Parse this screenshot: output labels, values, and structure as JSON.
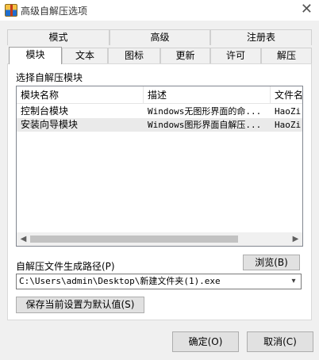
{
  "window": {
    "title": "高级自解压选项",
    "close_glyph": "✕"
  },
  "tabs_row1": [
    "模式",
    "高级",
    "注册表"
  ],
  "tabs_row2": [
    "模块",
    "文本",
    "图标",
    "更新",
    "许可",
    "解压"
  ],
  "active_tab": "模块",
  "module_section": {
    "label": "选择自解压模块",
    "columns": [
      "模块名称",
      "描述",
      "文件名"
    ],
    "rows": [
      {
        "name": "控制台模块",
        "desc": "Windows无图形界面的命...",
        "file": "HaoZi..."
      },
      {
        "name": "安装向导模块",
        "desc": "Windows图形界面自解压...",
        "file": "HaoZi..."
      }
    ]
  },
  "path": {
    "label": "自解压文件生成路径(P)",
    "browse_label": "浏览(B)",
    "value": "C:\\Users\\admin\\Desktop\\新建文件夹(1).exe"
  },
  "save_default_label": "保存当前设置为默认值(S)",
  "ok_label": "确定(O)",
  "cancel_label": "取消(C)"
}
